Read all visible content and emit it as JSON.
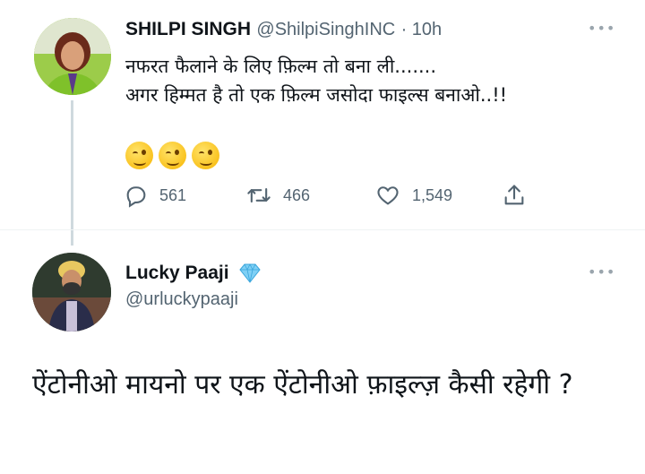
{
  "tweet": {
    "author_name": "SHILPI SINGH",
    "author_handle": "@ShilpiSinghINC",
    "time": "· 10h",
    "text_line1": "नफरत फैलाने के लिए फ़िल्म तो बना ली.......",
    "text_line2": "अगर हिम्मत है तो एक फ़िल्म जसोदा फाइल्स बनाओ..!!",
    "emojis": [
      "winking-face-emoji",
      "winking-face-emoji",
      "winking-face-emoji"
    ],
    "replies": "561",
    "retweets": "466",
    "likes": "1,549"
  },
  "reply": {
    "author_name": "Lucky Paaji",
    "author_handle": "@urluckypaaji",
    "verified_icon": "diamond-icon",
    "text": "ऐंटोनीओ मायनो पर एक ऐंटोनीओ फ़ाइल्ज़ कैसी रहेगी ?"
  },
  "colors": {
    "text": "#0f1419",
    "muted": "#536471",
    "diamond": "#4cb9f0"
  }
}
